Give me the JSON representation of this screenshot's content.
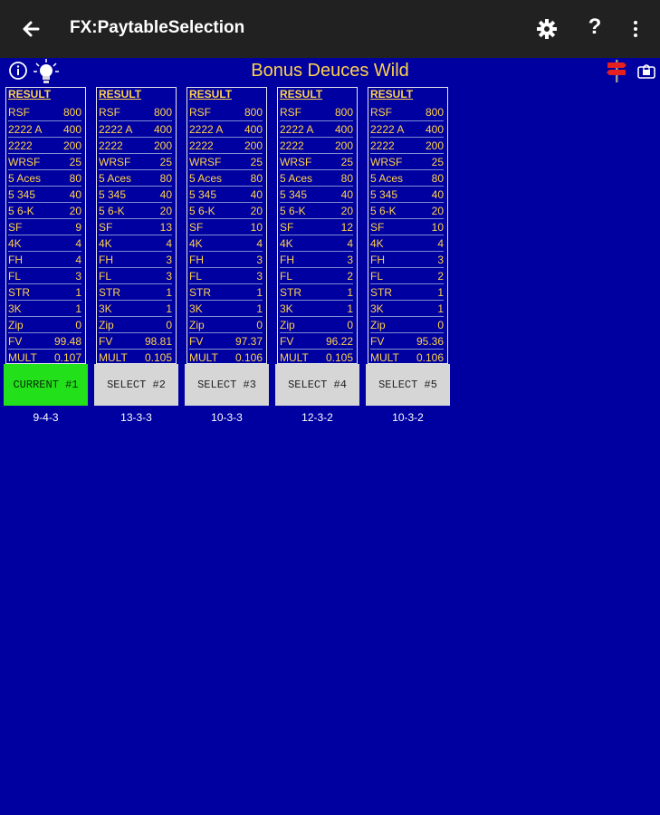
{
  "appbar": {
    "title": "FX:PaytableSelection",
    "help_label": "?"
  },
  "game_title": "Bonus Deuces Wild",
  "colors": {
    "background": "#0000a0",
    "text": "#ffd24a",
    "current": "#22e019",
    "button": "#d6d6d6"
  },
  "paytables": [
    {
      "header": "RESULT",
      "button": "CURRENT #1",
      "current": true,
      "code": "9-4-3",
      "rows": [
        [
          "RSF",
          "800"
        ],
        [
          "2222 A",
          "400"
        ],
        [
          "2222",
          "200"
        ],
        [
          "WRSF",
          "25"
        ],
        [
          "5 Aces",
          "80"
        ],
        [
          "5 345",
          "40"
        ],
        [
          "5 6-K",
          "20"
        ],
        [
          "SF",
          "9"
        ],
        [
          "4K",
          "4"
        ],
        [
          "FH",
          "4"
        ],
        [
          "FL",
          "3"
        ],
        [
          "STR",
          "1"
        ],
        [
          "3K",
          "1"
        ],
        [
          "Zip",
          "0"
        ],
        [
          "FV",
          "99.48"
        ],
        [
          "MULT",
          "0.107"
        ]
      ]
    },
    {
      "header": "RESULT",
      "button": "SELECT #2",
      "current": false,
      "code": "13-3-3",
      "rows": [
        [
          "RSF",
          "800"
        ],
        [
          "2222 A",
          "400"
        ],
        [
          "2222",
          "200"
        ],
        [
          "WRSF",
          "25"
        ],
        [
          "5 Aces",
          "80"
        ],
        [
          "5 345",
          "40"
        ],
        [
          "5 6-K",
          "20"
        ],
        [
          "SF",
          "13"
        ],
        [
          "4K",
          "4"
        ],
        [
          "FH",
          "3"
        ],
        [
          "FL",
          "3"
        ],
        [
          "STR",
          "1"
        ],
        [
          "3K",
          "1"
        ],
        [
          "Zip",
          "0"
        ],
        [
          "FV",
          "98.81"
        ],
        [
          "MULT",
          "0.105"
        ]
      ]
    },
    {
      "header": "RESULT",
      "button": "SELECT #3",
      "current": false,
      "code": "10-3-3",
      "rows": [
        [
          "RSF",
          "800"
        ],
        [
          "2222 A",
          "400"
        ],
        [
          "2222",
          "200"
        ],
        [
          "WRSF",
          "25"
        ],
        [
          "5 Aces",
          "80"
        ],
        [
          "5 345",
          "40"
        ],
        [
          "5 6-K",
          "20"
        ],
        [
          "SF",
          "10"
        ],
        [
          "4K",
          "4"
        ],
        [
          "FH",
          "3"
        ],
        [
          "FL",
          "3"
        ],
        [
          "STR",
          "1"
        ],
        [
          "3K",
          "1"
        ],
        [
          "Zip",
          "0"
        ],
        [
          "FV",
          "97.37"
        ],
        [
          "MULT",
          "0.106"
        ]
      ]
    },
    {
      "header": "RESULT",
      "button": "SELECT #4",
      "current": false,
      "code": "12-3-2",
      "rows": [
        [
          "RSF",
          "800"
        ],
        [
          "2222 A",
          "400"
        ],
        [
          "2222",
          "200"
        ],
        [
          "WRSF",
          "25"
        ],
        [
          "5 Aces",
          "80"
        ],
        [
          "5 345",
          "40"
        ],
        [
          "5 6-K",
          "20"
        ],
        [
          "SF",
          "12"
        ],
        [
          "4K",
          "4"
        ],
        [
          "FH",
          "3"
        ],
        [
          "FL",
          "2"
        ],
        [
          "STR",
          "1"
        ],
        [
          "3K",
          "1"
        ],
        [
          "Zip",
          "0"
        ],
        [
          "FV",
          "96.22"
        ],
        [
          "MULT",
          "0.105"
        ]
      ]
    },
    {
      "header": "RESULT",
      "button": "SELECT #5",
      "current": false,
      "code": "10-3-2",
      "rows": [
        [
          "RSF",
          "800"
        ],
        [
          "2222 A",
          "400"
        ],
        [
          "2222",
          "200"
        ],
        [
          "WRSF",
          "25"
        ],
        [
          "5 Aces",
          "80"
        ],
        [
          "5 345",
          "40"
        ],
        [
          "5 6-K",
          "20"
        ],
        [
          "SF",
          "10"
        ],
        [
          "4K",
          "4"
        ],
        [
          "FH",
          "3"
        ],
        [
          "FL",
          "2"
        ],
        [
          "STR",
          "1"
        ],
        [
          "3K",
          "1"
        ],
        [
          "Zip",
          "0"
        ],
        [
          "FV",
          "95.36"
        ],
        [
          "MULT",
          "0.106"
        ]
      ]
    }
  ]
}
